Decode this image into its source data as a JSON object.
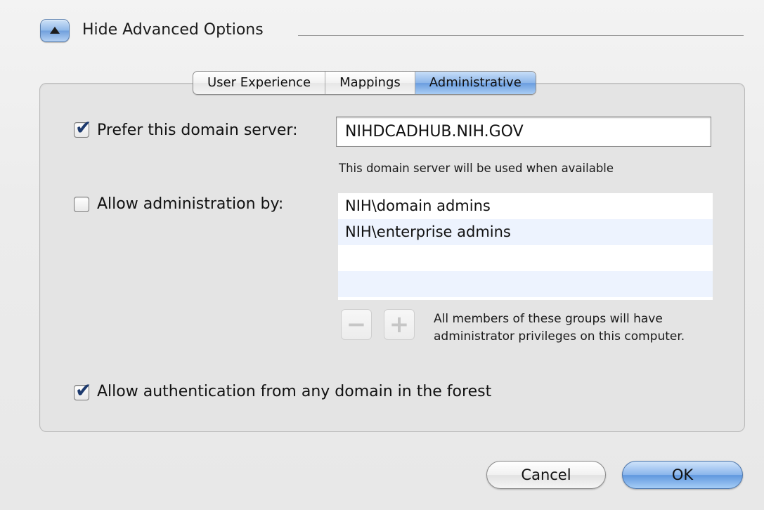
{
  "disclosure": {
    "label": "Hide Advanced Options"
  },
  "tabs": [
    {
      "label": "User Experience",
      "selected": false
    },
    {
      "label": "Mappings",
      "selected": false
    },
    {
      "label": "Administrative",
      "selected": true
    }
  ],
  "prefer_server": {
    "checked": true,
    "label": "Prefer this domain server:",
    "value": "NIHDCADHUB.NIH.GOV",
    "hint": "This domain server will be used when available"
  },
  "allow_admin": {
    "checked": false,
    "label": "Allow administration by:",
    "groups": [
      "NIH\\domain admins",
      "NIH\\enterprise admins"
    ],
    "remove_glyph": "−",
    "add_glyph": "+",
    "note": "All members of these groups will have administrator privileges on this computer."
  },
  "allow_auth": {
    "checked": true,
    "label": "Allow authentication from any domain in the forest"
  },
  "buttons": {
    "cancel": "Cancel",
    "ok": "OK"
  },
  "check_glyph": "✔",
  "colors": {
    "accent_blue": "#8db6ea",
    "checkmark": "#1d3a6e"
  }
}
